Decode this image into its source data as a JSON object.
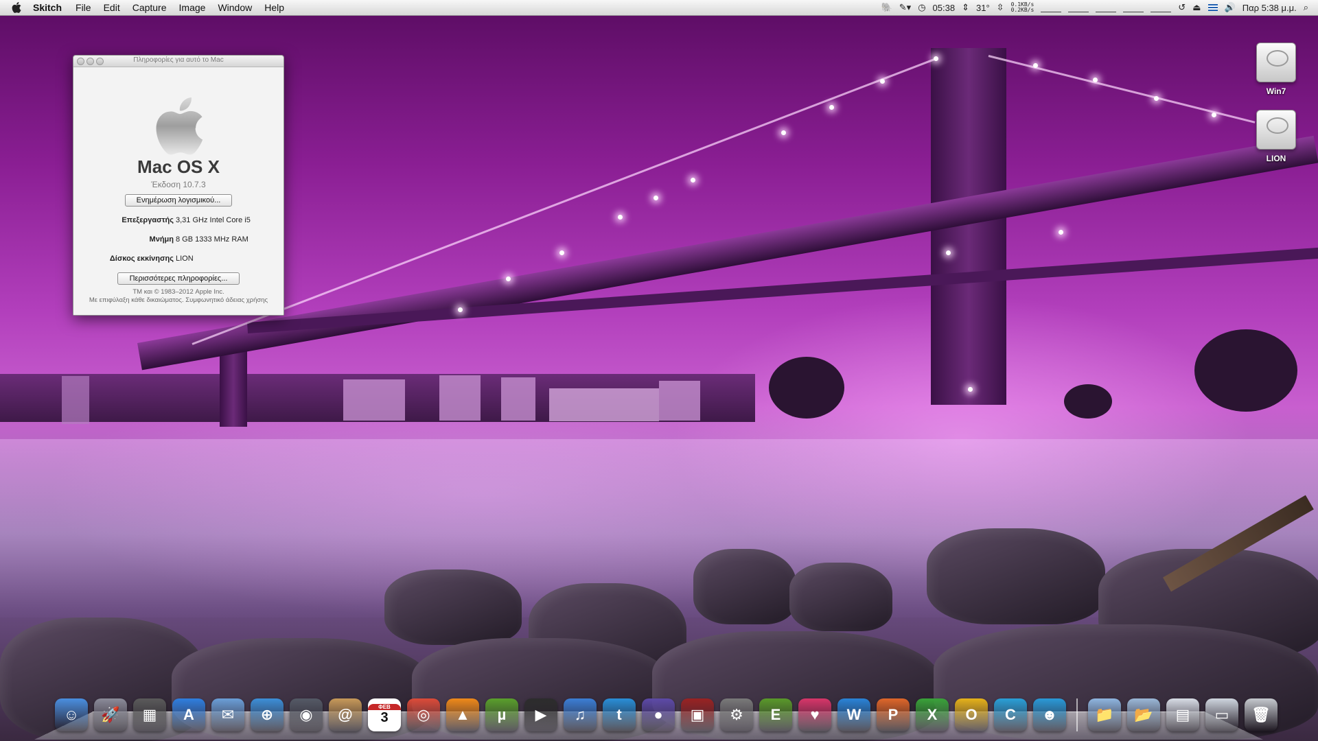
{
  "menubar": {
    "app_name": "Skitch",
    "menus": [
      "File",
      "Edit",
      "Capture",
      "Image",
      "Window",
      "Help"
    ],
    "status": {
      "time_small": "05:38",
      "temperature": "31°",
      "net_up": "0.1KB/s",
      "net_down": "0.2KB/s",
      "clock": "Παρ 5:38 μ.μ."
    }
  },
  "about_window": {
    "title": "Πληροφορίες για αυτό το Mac",
    "os_name": "Mac OS X",
    "version": "Έκδοση 10.7.3",
    "update_button": "Ενημέρωση λογισμικού...",
    "rows": [
      {
        "label": "Επεξεργαστής",
        "value": "3,31 GHz Intel Core i5"
      },
      {
        "label": "Μνήμη",
        "value": "8 GB 1333 MHz  RAM"
      },
      {
        "label": "Δίσκος εκκίνησης",
        "value": "LION"
      }
    ],
    "more_info_button": "Περισσότερες πληροφορίες...",
    "legal_line1": "TM και © 1983–2012 Apple Inc.",
    "legal_line2": "Με επιφύλαξη κάθε δικαιώματος. Συμφωνητικό άδειας χρήσης"
  },
  "desktop_drives": [
    {
      "label": "Win7"
    },
    {
      "label": "LION"
    }
  ],
  "dock": {
    "calendar_day": "3",
    "calendar_month": "ΦΕΒ",
    "items": [
      {
        "name": "finder",
        "glyph": "☺",
        "color": "#4a8fe0"
      },
      {
        "name": "launchpad",
        "glyph": "🚀",
        "color": "#8c8c9a"
      },
      {
        "name": "photo-booth",
        "glyph": "▦",
        "color": "#5b5b5b"
      },
      {
        "name": "app-store",
        "glyph": "A",
        "color": "#2f7fe0"
      },
      {
        "name": "mail",
        "glyph": "✉",
        "color": "#6b9fd8"
      },
      {
        "name": "safari",
        "glyph": "⊕",
        "color": "#3d8fd8"
      },
      {
        "name": "facetime",
        "glyph": "◉",
        "color": "#555a66"
      },
      {
        "name": "address-book",
        "glyph": "@",
        "color": "#c89a5a"
      },
      {
        "name": "ical",
        "glyph": "3",
        "color": "#ffffff"
      },
      {
        "name": "chrome",
        "glyph": "◎",
        "color": "#dd4b39"
      },
      {
        "name": "vlc",
        "glyph": "▲",
        "color": "#f08a1a"
      },
      {
        "name": "utorrent",
        "glyph": "µ",
        "color": "#5aa02c"
      },
      {
        "name": "dvd-player",
        "glyph": "▶",
        "color": "#2d2d2d"
      },
      {
        "name": "itunes",
        "glyph": "♫",
        "color": "#3c7fd6"
      },
      {
        "name": "twitter",
        "glyph": "t",
        "color": "#2a8fd8"
      },
      {
        "name": "network-globe",
        "glyph": "●",
        "color": "#5d4aa8"
      },
      {
        "name": "photo-slideshow",
        "glyph": "▣",
        "color": "#9a2323"
      },
      {
        "name": "system-preferences",
        "glyph": "⚙",
        "color": "#7a7a7a"
      },
      {
        "name": "evernote",
        "glyph": "E",
        "color": "#5a9a2a"
      },
      {
        "name": "heart-app",
        "glyph": "♥",
        "color": "#d8366a"
      },
      {
        "name": "word",
        "glyph": "W",
        "color": "#2a84d8"
      },
      {
        "name": "powerpoint",
        "glyph": "P",
        "color": "#e0672a"
      },
      {
        "name": "excel",
        "glyph": "X",
        "color": "#3aa33a"
      },
      {
        "name": "outlook",
        "glyph": "O",
        "color": "#e6b21a"
      },
      {
        "name": "communicator",
        "glyph": "C",
        "color": "#2aa0d8"
      },
      {
        "name": "messenger",
        "glyph": "☻",
        "color": "#2a9ad8"
      }
    ],
    "right_items": [
      {
        "name": "applications-folder",
        "glyph": "📁",
        "color": "#8fb6e0"
      },
      {
        "name": "documents-folder",
        "glyph": "📂",
        "color": "#9bb8d8"
      },
      {
        "name": "document-stack",
        "glyph": "▤",
        "color": "#d8dde6"
      },
      {
        "name": "chrome-window",
        "glyph": "▭",
        "color": "#cfd6df"
      },
      {
        "name": "trash",
        "glyph": "🗑",
        "color": "#c5c9ce"
      }
    ]
  }
}
